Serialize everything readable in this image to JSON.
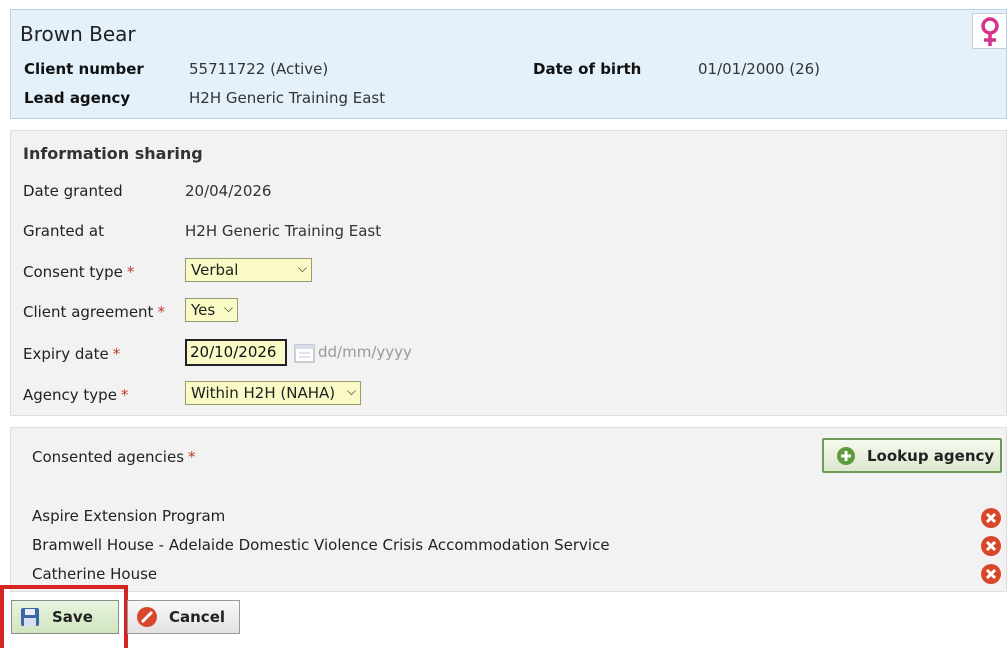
{
  "client": {
    "name": "Brown Bear",
    "client_number_label": "Client number",
    "client_number": "55711722 (Active)",
    "dob_label": "Date of birth",
    "dob": "01/01/2000 (26)",
    "lead_agency_label": "Lead agency",
    "lead_agency": "H2H Generic Training East",
    "gender_icon": "female-icon"
  },
  "info_sharing": {
    "title": "Information sharing",
    "date_granted_label": "Date granted",
    "date_granted": "20/04/2026",
    "granted_at_label": "Granted at",
    "granted_at": "H2H Generic Training East",
    "consent_type_label": "Consent type",
    "consent_type": "Verbal",
    "client_agreement_label": "Client agreement",
    "client_agreement": "Yes",
    "expiry_date_label": "Expiry date",
    "expiry_date": "20/10/2026",
    "expiry_placeholder": "dd/mm/yyyy",
    "agency_type_label": "Agency type",
    "agency_type": "Within H2H (NAHA)",
    "required_marker": "*"
  },
  "agencies": {
    "label": "Consented agencies",
    "lookup_label": "Lookup agency",
    "items": [
      "Aspire Extension Program",
      "Bramwell House - Adelaide Domestic Violence Crisis Accommodation Service",
      "Catherine House"
    ]
  },
  "actions": {
    "save_label": "Save",
    "cancel_label": "Cancel"
  },
  "colors": {
    "header_bg": "#e4f1fa",
    "section_bg": "#f2f2f2",
    "select_bg": "#fafac6",
    "remove_red": "#d9472b",
    "highlight": "#d42424",
    "gender_pink": "#d6338a"
  }
}
